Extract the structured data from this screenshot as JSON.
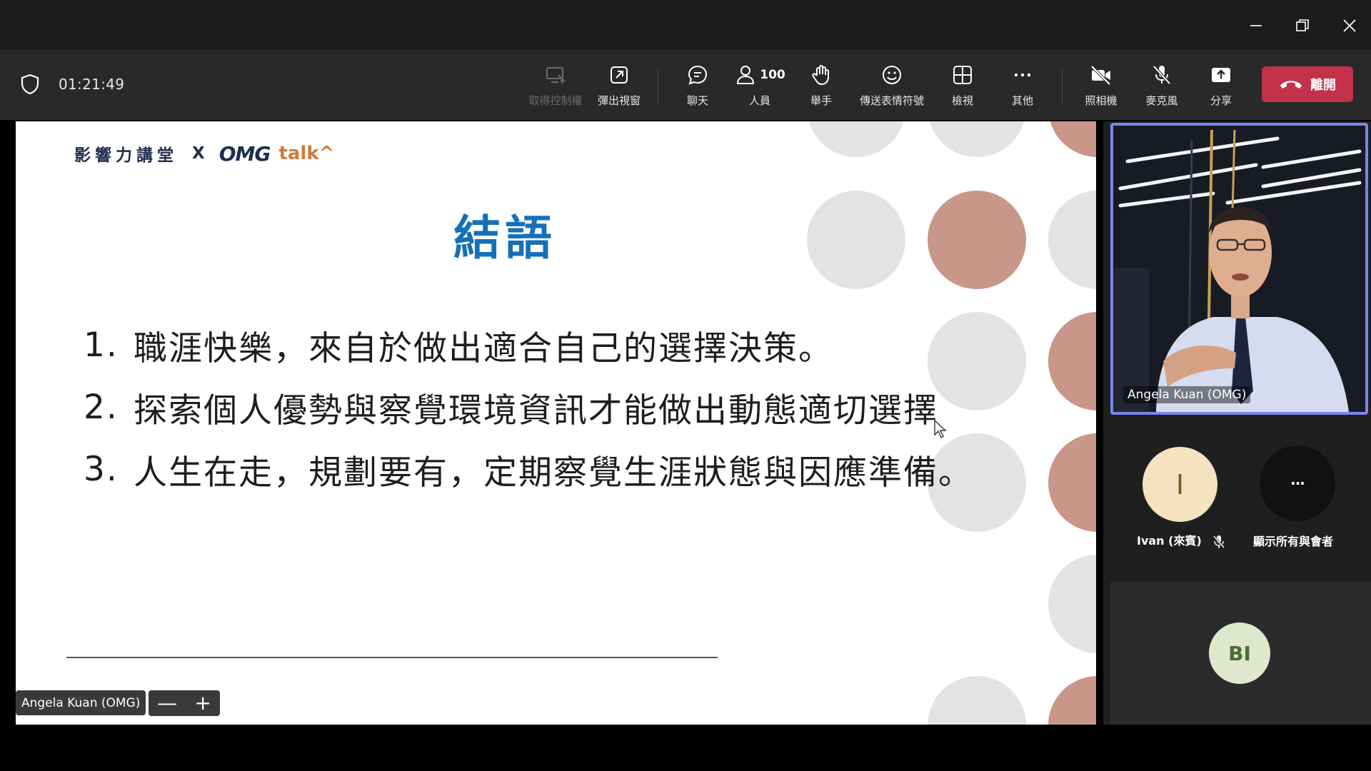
{
  "window": {
    "minimize_icon": "minimize-icon",
    "restore_icon": "restore-icon",
    "close_icon": "close-icon"
  },
  "toolbar": {
    "timer": "01:21:49",
    "take_control": "取得控制權",
    "popout": "彈出視窗",
    "chat": "聊天",
    "people_count": "100",
    "people": "人員",
    "raise_hand": "舉手",
    "reactions": "傳送表情符號",
    "view": "檢視",
    "more": "其他",
    "camera": "照相機",
    "mic": "麥克風",
    "share": "分享",
    "leave": "離開"
  },
  "slide": {
    "brand_zh": "影響力講堂",
    "brand_x": "X",
    "brand_omg": "OMG",
    "brand_talk": "talk^",
    "title": "結語",
    "items": [
      {
        "num": "1.",
        "text": "職涯快樂，來自於做出適合自己的選擇決策。"
      },
      {
        "num": "2.",
        "text": "探索個人優勢與察覺環境資訊才能做出動態適切選擇"
      },
      {
        "num": "3.",
        "text": "人生在走，規劃要有，定期察覺生涯狀態與因應準備。"
      }
    ],
    "colors": {
      "title": "#1570b8",
      "circle_brown": "#c9968a",
      "circle_gray": "#e3e3e3"
    }
  },
  "stage": {
    "presenter_tag": "Angela Kuan (OMG)",
    "zoom_out": "—",
    "zoom_in": "+"
  },
  "participants": {
    "main_video_name": "Angela Kuan (OMG)",
    "ivan_initial": "I",
    "ivan_label": "Ivan (來賓)",
    "show_all_symbol": "···",
    "show_all_label": "顯示所有與會者",
    "bi_initials": "BI"
  },
  "colors": {
    "accent": "#7b83eb",
    "leave": "#c4314b",
    "toolbar_bg": "#292929"
  }
}
